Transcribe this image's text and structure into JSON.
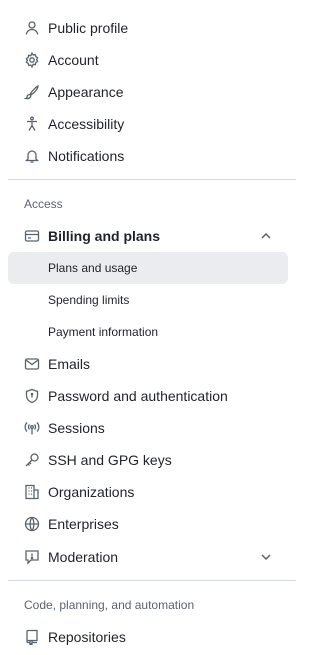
{
  "nav": {
    "top_items": [
      {
        "label": "Public profile",
        "icon": "person-icon"
      },
      {
        "label": "Account",
        "icon": "gear-icon"
      },
      {
        "label": "Appearance",
        "icon": "paintbrush-icon"
      },
      {
        "label": "Accessibility",
        "icon": "accessibility-icon"
      },
      {
        "label": "Notifications",
        "icon": "bell-icon"
      }
    ],
    "access_heading": "Access",
    "billing": {
      "label": "Billing and plans",
      "icon": "credit-card-icon",
      "expanded": true,
      "sub_items": [
        {
          "label": "Plans and usage",
          "active": true
        },
        {
          "label": "Spending limits",
          "active": false
        },
        {
          "label": "Payment information",
          "active": false
        }
      ]
    },
    "access_items": [
      {
        "label": "Emails",
        "icon": "mail-icon"
      },
      {
        "label": "Password and authentication",
        "icon": "shield-lock-icon"
      },
      {
        "label": "Sessions",
        "icon": "broadcast-icon"
      },
      {
        "label": "SSH and GPG keys",
        "icon": "key-icon"
      },
      {
        "label": "Organizations",
        "icon": "organization-icon"
      },
      {
        "label": "Enterprises",
        "icon": "globe-icon"
      },
      {
        "label": "Moderation",
        "icon": "report-icon"
      }
    ],
    "code_heading": "Code, planning, and automation",
    "code_items": [
      {
        "label": "Repositories",
        "icon": "repo-icon"
      }
    ]
  },
  "colors": {
    "accent": "#0969da",
    "active_bg": "#eaecf0",
    "text": "#1f2328",
    "muted": "#59636e",
    "divider": "#d1d9e0"
  }
}
